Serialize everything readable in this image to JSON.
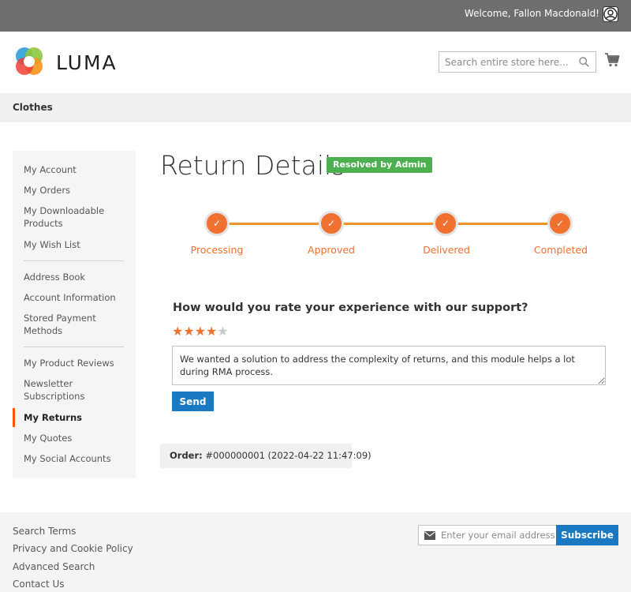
{
  "topbar": {
    "welcome": "Welcome, Fallon Macdonald!"
  },
  "header": {
    "logo_text": "LUMA",
    "search_placeholder": "Search entire store here...",
    "icons": {
      "search": "search-icon",
      "cart": "cart-icon",
      "user": "user-icon"
    }
  },
  "nav": {
    "items": [
      {
        "label": "Clothes"
      }
    ]
  },
  "sidebar": {
    "items": [
      {
        "label": "My Account"
      },
      {
        "label": "My Orders"
      },
      {
        "label": "My Downloadable Products"
      },
      {
        "label": "My Wish List"
      },
      {
        "label": "Address Book"
      },
      {
        "label": "Account Information"
      },
      {
        "label": "Stored Payment Methods"
      },
      {
        "label": "My Product Reviews"
      },
      {
        "label": "Newsletter Subscriptions"
      },
      {
        "label": "My Returns"
      },
      {
        "label": "My Quotes"
      },
      {
        "label": "My Social Accounts"
      }
    ],
    "active": "My Returns",
    "active_color": "#ff5501"
  },
  "main": {
    "title": "Return Details",
    "status": "Resolved by Admin",
    "status_color": "#4caf50",
    "steps": [
      {
        "label": "Processing",
        "done": true
      },
      {
        "label": "Approved",
        "done": true
      },
      {
        "label": "Delivered",
        "done": true
      },
      {
        "label": "Completed",
        "done": true
      }
    ],
    "progress_color": "#f07030",
    "rating": {
      "question": "How would you rate your experience with our support?",
      "stars_total": 5,
      "stars_filled": 4,
      "feedback": "We wanted a solution to address the complexity of returns, and this module helps a lot during RMA process.",
      "send_label": "Send"
    },
    "order": {
      "label": "Order:",
      "value": "#000000001 (2022-04-22 11:47:09)"
    }
  },
  "footer": {
    "links": [
      {
        "label": "Search Terms"
      },
      {
        "label": "Privacy and Cookie Policy"
      },
      {
        "label": "Advanced Search"
      },
      {
        "label": "Contact Us"
      }
    ],
    "newsletter_placeholder": "Enter your email address",
    "subscribe_label": "Subscribe"
  }
}
